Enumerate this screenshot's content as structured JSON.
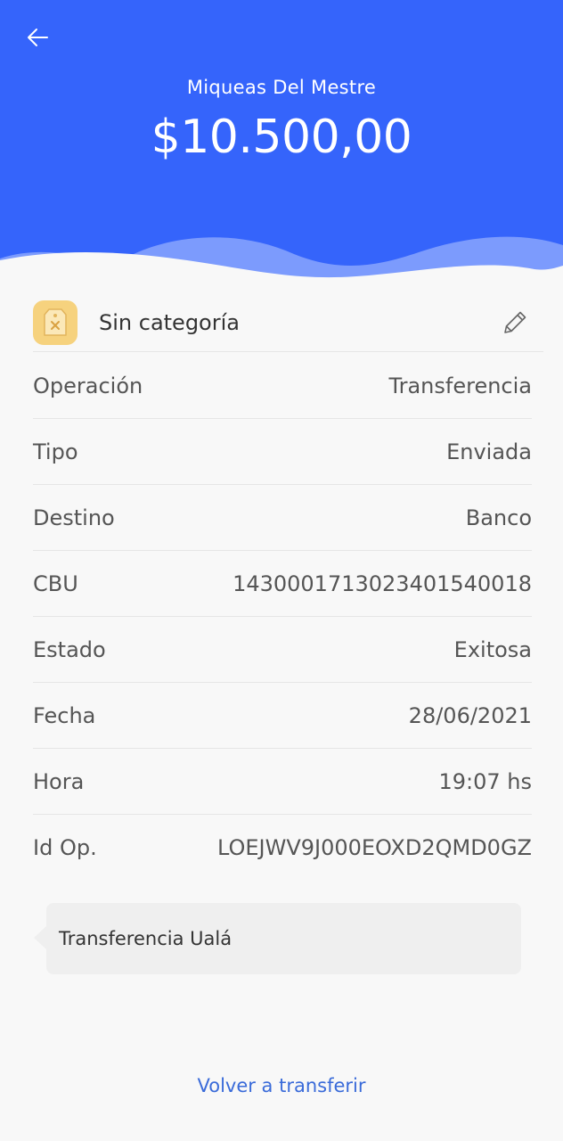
{
  "header": {
    "recipient": "Miqueas Del Mestre",
    "amount": "$10.500,00",
    "background_color": "#3564fb",
    "wave_color": "#7c9bfd"
  },
  "category": {
    "label": "Sin categoría",
    "icon": "tag-x-icon",
    "icon_bg_color": "#f6d27e"
  },
  "details": [
    {
      "label": "Operación",
      "value": "Transferencia"
    },
    {
      "label": "Tipo",
      "value": "Enviada"
    },
    {
      "label": "Destino",
      "value": "Banco"
    },
    {
      "label": "CBU",
      "value": "1430001713023401540018"
    },
    {
      "label": "Estado",
      "value": "Exitosa"
    },
    {
      "label": "Fecha",
      "value": "28/06/2021"
    },
    {
      "label": "Hora",
      "value": "19:07 hs"
    },
    {
      "label": "Id Op.",
      "value": "LOEJWV9J000EOXD2QMD0GZ"
    }
  ],
  "note": {
    "text": "Transferencia Ualá"
  },
  "footer": {
    "back_link_label": "Volver a transferir",
    "link_color": "#3a6bd9"
  }
}
